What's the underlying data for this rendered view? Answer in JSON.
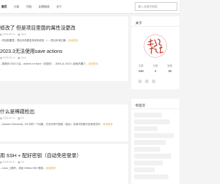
{
  "nav": {
    "items": [
      {
        "label": "首页",
        "active": true
      },
      {
        "label": "分类",
        "active": false
      },
      {
        "label": "归档",
        "active": false
      },
      {
        "label": "友情链接",
        "active": false
      },
      {
        "label": "关于",
        "active": false
      }
    ]
  },
  "search": {
    "placeholder": "输入关键字搜索"
  },
  "posts": [
    {
      "title": "修改了 但是项目里面的属性没更改",
      "date": "2025-06-11",
      "category": "Java",
      "excerpt": "...项目配置里，项目中的属性却没有改变...一...项目本来正确...",
      "more": "阅读更多"
    },
    {
      "title": "2023.3无法使用save actions",
      "date": "2025-06-11",
      "category": "Java",
      "excerpt": "...更新到 2023.3 后，Actions on Save（无插件）...IDEA 从 2022.1 起就内置了...",
      "more": "阅读更多"
    },
    {
      "title": "什么是稀疏检出",
      "date": "2025-06-11",
      "category": "Git",
      "excerpt": "...(Sparse Checkout)...Git 中的一个功能，它允许你只检取（检出）仓库中的部分目录或文件...",
      "more": "阅读更多"
    },
    {
      "title": "用 SSH + 配好密钥（自动免密登录）",
      "date": "2025-06-11",
      "category": "Git",
      "excerpt": "...Linux 上操作，添加 GitHub SSH 登录...",
      "more": "阅读更多"
    }
  ],
  "sidebar": {
    "about_title": "关于",
    "stats": [
      {
        "label": "文章",
        "value": "348"
      },
      {
        "label": "分类",
        "value": "4"
      },
      {
        "label": "标签",
        "value": "39"
      }
    ],
    "tags_title": "标签云"
  },
  "colors": {
    "accent": "#e8a83a",
    "background": "#f4f4f4",
    "card": "#ffffff"
  }
}
